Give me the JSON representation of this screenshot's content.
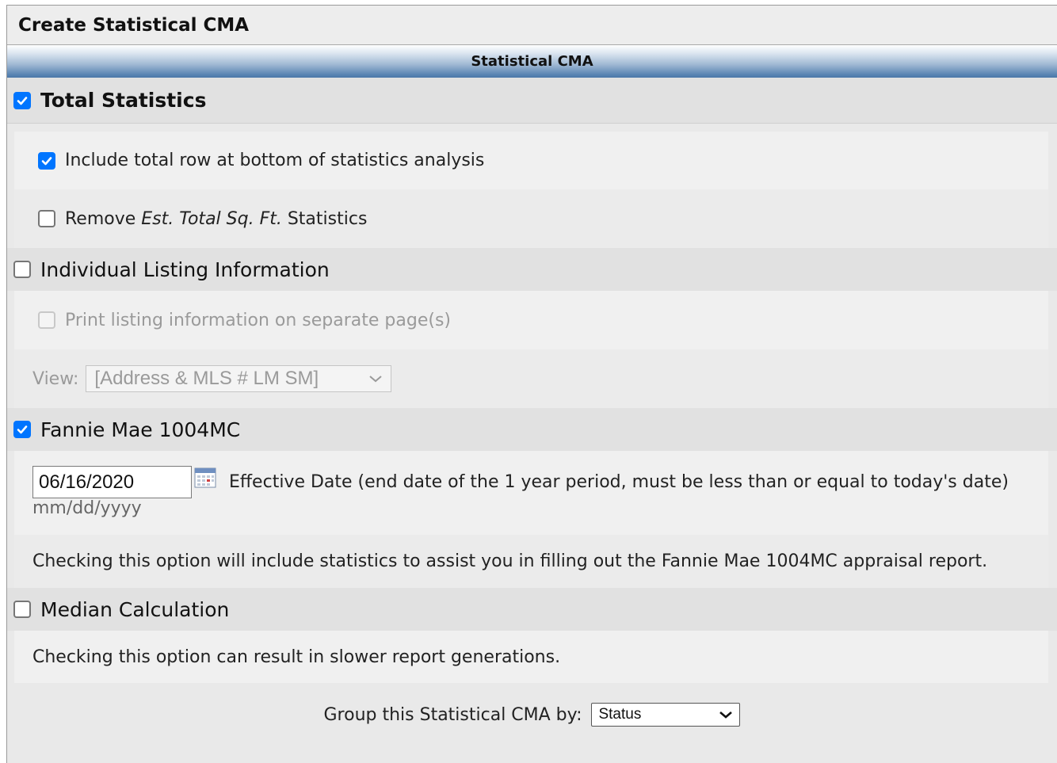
{
  "window": {
    "title": "Create Statistical CMA"
  },
  "section": {
    "header": "Statistical CMA"
  },
  "total_statistics": {
    "label": "Total Statistics",
    "checked": true,
    "include_total_row": {
      "label": "Include total row at bottom of statistics analysis",
      "checked": true
    },
    "remove_sqft": {
      "label_prefix": "Remove ",
      "label_italic": "Est. Total Sq. Ft.",
      "label_suffix": " Statistics",
      "checked": false
    }
  },
  "individual_listing": {
    "label": "Individual Listing Information",
    "checked": false,
    "print_separate": {
      "label": "Print listing information on separate page(s)",
      "checked": false,
      "disabled": true
    },
    "view": {
      "label": "View:",
      "selected": "[Address & MLS # LM SM]",
      "disabled": true
    }
  },
  "fannie_mae": {
    "label": "Fannie Mae 1004MC",
    "checked": true,
    "date_value": "06/16/2020",
    "date_format": "mm/dd/yyyy",
    "effective_date_label": "Effective Date (end date of the 1 year period, must be less than or equal to today's date)",
    "note": "Checking this option will include statistics to assist you in filling out the Fannie Mae 1004MC appraisal report."
  },
  "median": {
    "label": "Median Calculation",
    "checked": false,
    "note": "Checking this option can result in slower report generations."
  },
  "group_by": {
    "label": "Group this Statistical CMA by:",
    "selected": "Status"
  },
  "colors": {
    "accent": "#0075ff",
    "header_blue": "#4a77a8",
    "background": "#e9e9e9"
  }
}
